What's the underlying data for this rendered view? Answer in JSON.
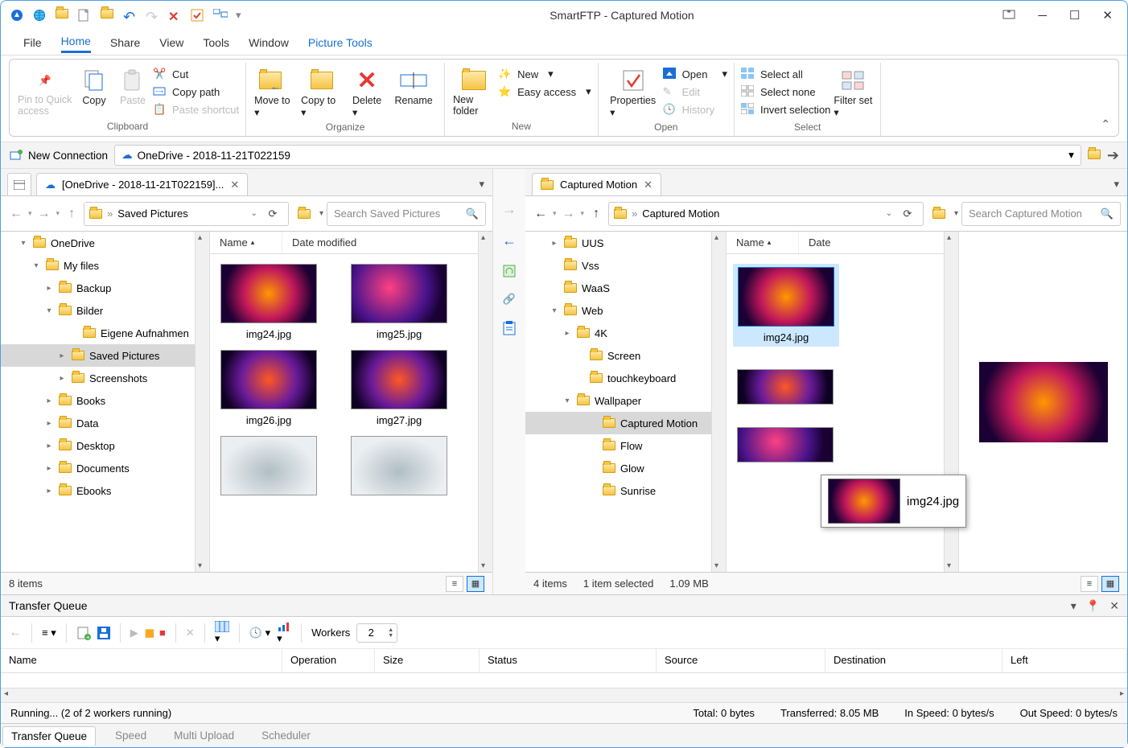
{
  "app": {
    "title": "SmartFTP - Captured Motion"
  },
  "menu": {
    "file": "File",
    "home": "Home",
    "share": "Share",
    "view": "View",
    "tools": "Tools",
    "window": "Window",
    "pictureTools": "Picture Tools"
  },
  "ribbon": {
    "clipboard": {
      "label": "Clipboard",
      "pin": "Pin to Quick access",
      "copy": "Copy",
      "paste": "Paste",
      "cut": "Cut",
      "copyPath": "Copy path",
      "pasteShortcut": "Paste shortcut"
    },
    "organize": {
      "label": "Organize",
      "moveTo": "Move to",
      "copyTo": "Copy to",
      "delete": "Delete",
      "rename": "Rename"
    },
    "new_": {
      "label": "New",
      "newFolder": "New folder",
      "newItem": "New",
      "easyAccess": "Easy access"
    },
    "open": {
      "label": "Open",
      "properties": "Properties",
      "open": "Open",
      "edit": "Edit",
      "history": "History"
    },
    "select": {
      "label": "Select",
      "selectAll": "Select all",
      "selectNone": "Select none",
      "invert": "Invert selection",
      "filterSet": "Filter set"
    }
  },
  "connbar": {
    "newConnection": "New Connection",
    "current": "OneDrive - 2018-11-21T022159"
  },
  "leftPane": {
    "tab": "[OneDrive - 2018-11-21T022159]...",
    "crumb": "Saved Pictures",
    "searchPlaceholder": "Search Saved Pictures",
    "tree": [
      {
        "indent": 22,
        "expand": "▾",
        "label": "OneDrive"
      },
      {
        "indent": 38,
        "expand": "▾",
        "label": "My files"
      },
      {
        "indent": 54,
        "expand": "▸",
        "label": "Backup"
      },
      {
        "indent": 54,
        "expand": "▾",
        "label": "Bilder"
      },
      {
        "indent": 84,
        "expand": "",
        "label": "Eigene Aufnahmen"
      },
      {
        "indent": 70,
        "expand": "▸",
        "label": "Saved Pictures",
        "selected": true
      },
      {
        "indent": 70,
        "expand": "▸",
        "label": "Screenshots"
      },
      {
        "indent": 54,
        "expand": "▸",
        "label": "Books"
      },
      {
        "indent": 54,
        "expand": "▸",
        "label": "Data"
      },
      {
        "indent": 54,
        "expand": "▸",
        "label": "Desktop"
      },
      {
        "indent": 54,
        "expand": "▸",
        "label": "Documents"
      },
      {
        "indent": 54,
        "expand": "▸",
        "label": "Ebooks"
      }
    ],
    "columns": {
      "name": "Name",
      "date": "Date modified"
    },
    "thumbs": [
      "img24.jpg",
      "img25.jpg",
      "img26.jpg",
      "img27.jpg"
    ],
    "status": "8 items"
  },
  "rightPane": {
    "tab": "Captured Motion",
    "crumb": "Captured Motion",
    "searchPlaceholder": "Search Captured Motion",
    "tree": [
      {
        "indent": 30,
        "expand": "▸",
        "label": "UUS"
      },
      {
        "indent": 30,
        "expand": "",
        "label": "Vss"
      },
      {
        "indent": 30,
        "expand": "",
        "label": "WaaS"
      },
      {
        "indent": 30,
        "expand": "▾",
        "label": "Web"
      },
      {
        "indent": 46,
        "expand": "▸",
        "label": "4K"
      },
      {
        "indent": 62,
        "expand": "",
        "label": "Screen"
      },
      {
        "indent": 62,
        "expand": "",
        "label": "touchkeyboard"
      },
      {
        "indent": 46,
        "expand": "▾",
        "label": "Wallpaper"
      },
      {
        "indent": 78,
        "expand": "",
        "label": "Captured Motion",
        "selected": true
      },
      {
        "indent": 78,
        "expand": "",
        "label": "Flow"
      },
      {
        "indent": 78,
        "expand": "",
        "label": "Glow"
      },
      {
        "indent": 78,
        "expand": "",
        "label": "Sunrise"
      }
    ],
    "columns": {
      "name": "Name",
      "date": "Date"
    },
    "thumbs": [
      "img24.jpg"
    ],
    "status1": "4 items",
    "status2": "1 item selected",
    "status3": "1.09 MB"
  },
  "dragTip": "img24.jpg",
  "queue": {
    "title": "Transfer Queue",
    "workersLabel": "Workers",
    "workersValue": "2",
    "cols": {
      "name": "Name",
      "operation": "Operation",
      "size": "Size",
      "status": "Status",
      "source": "Source",
      "destination": "Destination",
      "left": "Left"
    }
  },
  "statusbar": {
    "running": "Running... (2 of 2 workers running)",
    "total": "Total: 0 bytes",
    "transferred": "Transferred: 8.05 MB",
    "inSpeed": "In Speed: 0 bytes/s",
    "outSpeed": "Out Speed: 0 bytes/s"
  },
  "bottomTabs": {
    "queue": "Transfer Queue",
    "speed": "Speed",
    "multi": "Multi Upload",
    "scheduler": "Scheduler"
  }
}
